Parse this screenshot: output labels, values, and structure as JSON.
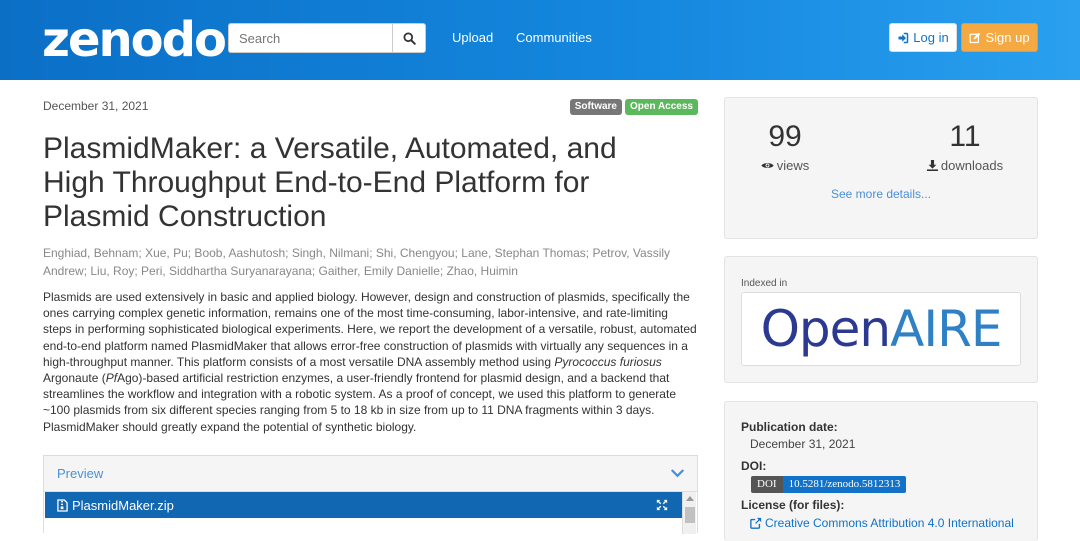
{
  "header": {
    "logo": "zenodo",
    "search_placeholder": "Search",
    "nav": [
      "Upload",
      "Communities"
    ],
    "login_label": "Log in",
    "signup_label": "Sign up"
  },
  "record": {
    "date": "December 31, 2021",
    "badges": [
      "Software",
      "Open Access"
    ],
    "title": "PlasmidMaker: a Versatile, Automated, and High Throughput End-to-End Platform for Plasmid Construction",
    "authors": "Enghiad, Behnam; Xue, Pu; Boob, Aashutosh; Singh, Nilmani; Shi, Chengyou; Lane, Stephan Thomas; Petrov, Vassily Andrew; Liu, Roy; Peri, Siddhartha Suryanarayana; Gaither, Emily Danielle; Zhao, Huimin",
    "abstract_1": "Plasmids are used extensively in basic and applied biology. However, design and construction of plasmids, specifically the ones carrying complex genetic information, remains one of the most time-consuming, labor-intensive, and rate-limiting steps in performing sophisticated biological experiments. Here, we report the development of a versatile, robust, automated end-to-end platform named PlasmidMaker that allows error-free construction of plasmids with virtually any sequences in a high-throughput manner. This platform consists of a most versatile DNA assembly method using",
    "abstract_species": "Pyrococcus furiosus",
    "abstract_2": " Argonaute (",
    "abstract_pf": "Pf",
    "abstract_3": "Ago)-based artificial restriction enzymes, a user-friendly frontend for plasmid design, and a backend that streamlines the workflow and integration with a robotic system. As a proof of concept, we used this platform to generate ~100 plasmids from six different species ranging from 5 to 18 kb in size from up to 11 DNA fragments within 3 days. PlasmidMaker should greatly expand the potential of synthetic biology."
  },
  "preview": {
    "label": "Preview",
    "file_name": "PlasmidMaker.zip"
  },
  "stats": {
    "views_num": "99",
    "views_label": "views",
    "downloads_num": "11",
    "downloads_label": "downloads",
    "see_more": "See more details..."
  },
  "indexed": {
    "label": "Indexed in",
    "logo_open": "Open",
    "logo_aire": "AIRE"
  },
  "pubinfo": {
    "pubdate_label": "Publication date:",
    "pubdate_value": "December 31, 2021",
    "doi_label": "DOI:",
    "doi_key": "DOI",
    "doi_value": "10.5281/zenodo.5812313",
    "license_label": "License (for files):",
    "license_value": "Creative Commons Attribution 4.0 International"
  },
  "colors": {
    "header_blue": "#1172c8",
    "signup_orange": "#f5a942",
    "open_access_green": "#5cb85c",
    "file_bar_blue": "#1167b1"
  }
}
